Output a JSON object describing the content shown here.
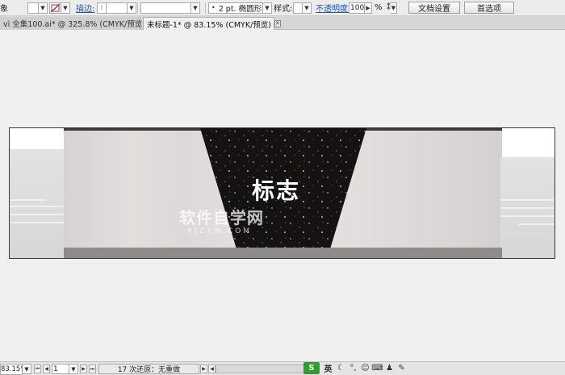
{
  "toolbar": {
    "label_left": "象",
    "stroke_label": "描边:",
    "stroke_weight_value": "",
    "brush_value": "",
    "brush_definition": "2 pt. 椭圆形",
    "style_label": "样式:",
    "opacity_label": "不透明度:",
    "opacity_value": "100",
    "opacity_unit": "%",
    "doc_setup_button": "文档设置",
    "preferences_button": "首选项"
  },
  "tabs": [
    {
      "label": "vi 全集100.ai* @ 325.8% (CMYK/预览)",
      "active": false
    },
    {
      "label": "未标题-1* @ 83.15% (CMYK/预览)",
      "active": true
    }
  ],
  "artwork": {
    "logo_text": "标志",
    "watermark_main": "软件自学网",
    "watermark_sub": "RJZXW.COM"
  },
  "statusbar": {
    "zoom": "83.15%",
    "page": "1",
    "status_text": "17 次还原：无重做",
    "ime_brand": "S",
    "ime_lang": "英"
  },
  "colors": {
    "accent_link": "#1f55b8",
    "ime_green": "#2f9e2f",
    "trapezoid": "#141213"
  }
}
